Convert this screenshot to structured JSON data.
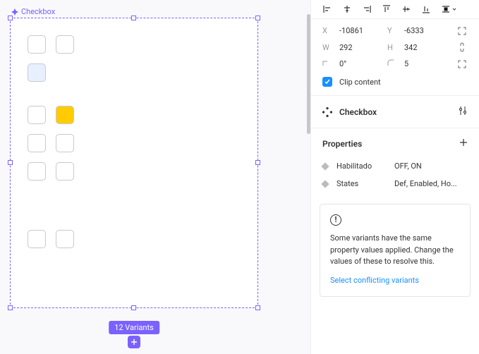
{
  "canvas": {
    "component_label": "Checkbox",
    "variants_badge": "12 Variants"
  },
  "variants": {
    "rows": [
      [
        {
          "fill": "white"
        },
        {
          "fill": "white"
        }
      ],
      [
        {
          "fill": "blue"
        }
      ],
      [
        {
          "fill": "white"
        },
        {
          "fill": "yellow"
        }
      ],
      [
        {
          "fill": "white"
        },
        {
          "fill": "white"
        }
      ],
      [
        {
          "fill": "white"
        },
        {
          "fill": "white"
        }
      ]
    ],
    "bottom_row": [
      {
        "fill": "white"
      },
      {
        "fill": "white"
      }
    ]
  },
  "inspector": {
    "position": {
      "x_label": "X",
      "x": "-10861",
      "y_label": "Y",
      "y": "-6333",
      "w_label": "W",
      "w": "292",
      "h_label": "H",
      "h": "342",
      "rot_label": "⌐",
      "rotation": "0°",
      "radius_label": "◠",
      "radius": "5",
      "clip_label": "Clip content"
    },
    "component": {
      "title": "Checkbox"
    },
    "properties_title": "Properties",
    "properties": [
      {
        "name": "Habilitado",
        "value": "OFF, ON"
      },
      {
        "name": "States",
        "value": "Def, Enabled, Ho..."
      }
    ],
    "warning": {
      "text": "Some variants have the same property values applied. Change the values of these to resolve this.",
      "link": "Select conflicting variants"
    }
  }
}
